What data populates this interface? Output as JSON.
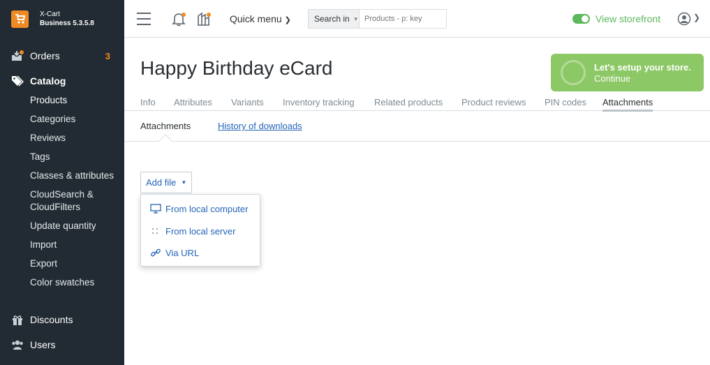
{
  "brand": {
    "name": "X-Cart",
    "version": "Business 5.3.5.8"
  },
  "sidebar": {
    "orders": {
      "label": "Orders",
      "badge": "3"
    },
    "catalog": {
      "label": "Catalog"
    },
    "catalog_items": [
      "Products",
      "Categories",
      "Reviews",
      "Tags",
      "Classes & attributes",
      "CloudSearch & CloudFilters",
      "Update quantity",
      "Import",
      "Export",
      "Color swatches"
    ],
    "discounts": {
      "label": "Discounts"
    },
    "users": {
      "label": "Users"
    }
  },
  "header": {
    "quick_menu": "Quick menu",
    "search_scope": "Search in",
    "search_placeholder": "Products - p: key",
    "view_storefront": "View storefront"
  },
  "page": {
    "title": "Happy Birthday eCard",
    "setup": {
      "line1": "Let's setup your store.",
      "line2": "Continue"
    },
    "tabs": [
      "Info",
      "Attributes",
      "Variants",
      "Inventory tracking",
      "Related products",
      "Product reviews",
      "PIN codes",
      "Attachments"
    ],
    "active_tab": "Attachments",
    "subtabs": {
      "attachments": "Attachments",
      "history": "History of downloads"
    },
    "add_file": "Add file",
    "add_file_menu": [
      "From local computer",
      "From local server",
      "Via URL"
    ]
  },
  "colors": {
    "sidebar_bg": "#222b33",
    "accent": "#f08a24",
    "link": "#2565b8",
    "success": "#5cb85c",
    "setup_bg": "#8cc865"
  }
}
